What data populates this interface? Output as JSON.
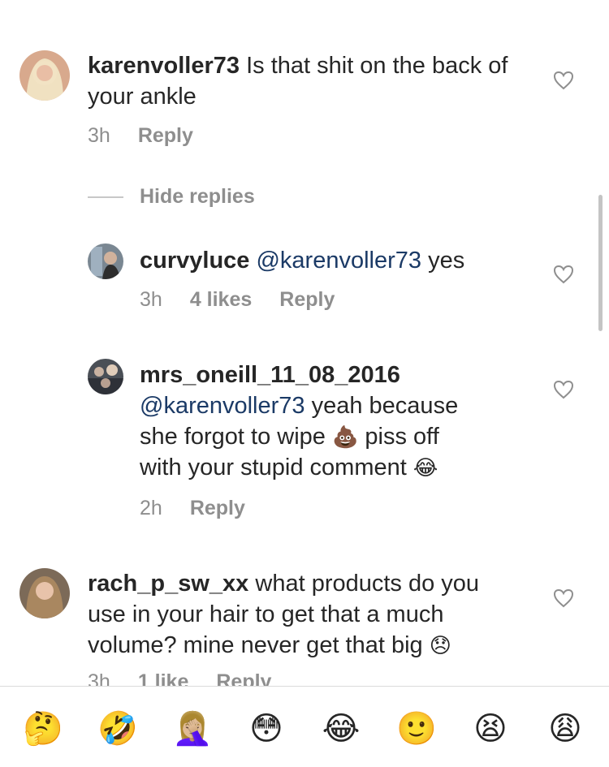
{
  "comments": [
    {
      "username": "karenvoller73",
      "text": "Is that shit on the back of your ankle",
      "time": "3h",
      "reply": "Reply"
    },
    {
      "hide_replies": "Hide replies"
    },
    {
      "username": "curvyluce",
      "mention": "@karenvoller73",
      "text": "yes",
      "time": "3h",
      "likes": "4 likes",
      "reply": "Reply"
    },
    {
      "username": "mrs_oneill_11_08_2016",
      "mention": "@karenvoller73",
      "text_1": "yeah because",
      "text_2": "she forgot to wipe",
      "text_3": "piss off",
      "text_4": "with your stupid comment",
      "time": "2h",
      "reply": "Reply"
    },
    {
      "username": "rach_p_sw_xx",
      "text_1": "what products do you",
      "text_2": "use in your hair to get that a much",
      "text_3": "volume? mine never get that big",
      "time": "3h",
      "likes": "1 like",
      "reply": "Reply"
    }
  ],
  "emoji_bar": [
    "🤔",
    "🤣",
    "🤦🏼‍♀️",
    "😳",
    "😂",
    "🙂",
    "😫",
    "😩"
  ],
  "inline_emoji": {
    "poop": "💩",
    "laugh": "😂",
    "sad": "😞"
  }
}
